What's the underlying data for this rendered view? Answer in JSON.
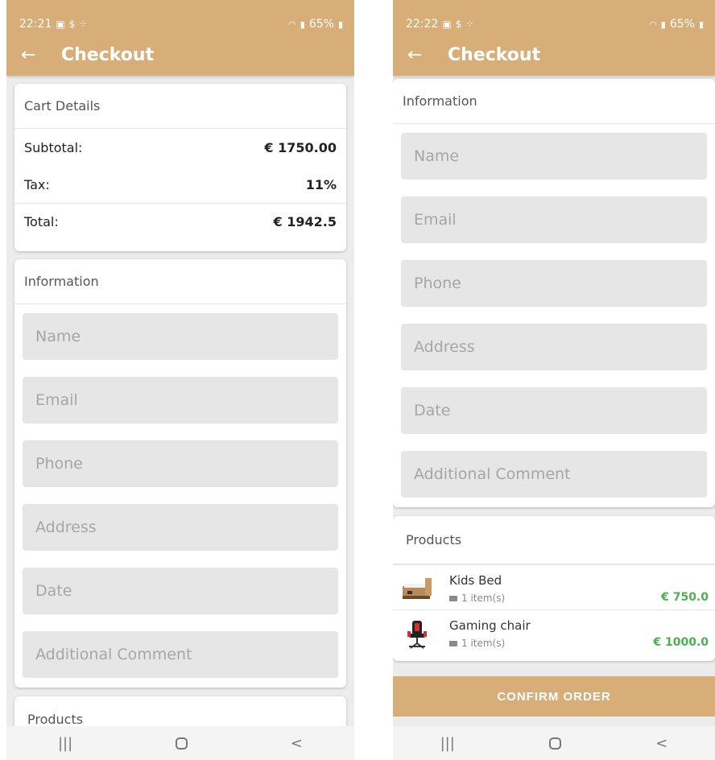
{
  "left": {
    "status": {
      "time": "22:21",
      "battery": "65%"
    },
    "appbar": {
      "back_icon": "←",
      "title": "Checkout"
    },
    "cart": {
      "header": "Cart Details",
      "rows": [
        {
          "label": "Subtotal:",
          "value": "€ 1750.00"
        },
        {
          "label": "Tax:",
          "value": "11%"
        },
        {
          "label": "Total:",
          "value": "€ 1942.5"
        }
      ]
    },
    "info": {
      "header": "Information",
      "fields": [
        "Name",
        "Email",
        "Phone",
        "Address",
        "Date",
        "Additional Comment"
      ]
    },
    "products_header": "Products"
  },
  "right": {
    "status": {
      "time": "22:22",
      "battery": "65%"
    },
    "appbar": {
      "back_icon": "←",
      "title": "Checkout"
    },
    "info": {
      "header": "Information",
      "fields": [
        "Name",
        "Email",
        "Phone",
        "Address",
        "Date",
        "Additional Comment"
      ]
    },
    "products": {
      "header": "Products",
      "items": [
        {
          "name": "Kids Bed",
          "qty": "1 item(s)",
          "price": "€ 750.0",
          "icon": "bed-icon"
        },
        {
          "name": "Gaming chair",
          "qty": "1 item(s)",
          "price": "€ 1000.0",
          "icon": "gaming-chair-icon"
        }
      ]
    },
    "confirm_label": "CONFIRM ORDER"
  },
  "navbar": {
    "recents": "|||",
    "back": "<"
  },
  "colors": {
    "accent": "#d7ae78",
    "price_green": "#4caf50",
    "field_bg": "#e6e6e6"
  }
}
